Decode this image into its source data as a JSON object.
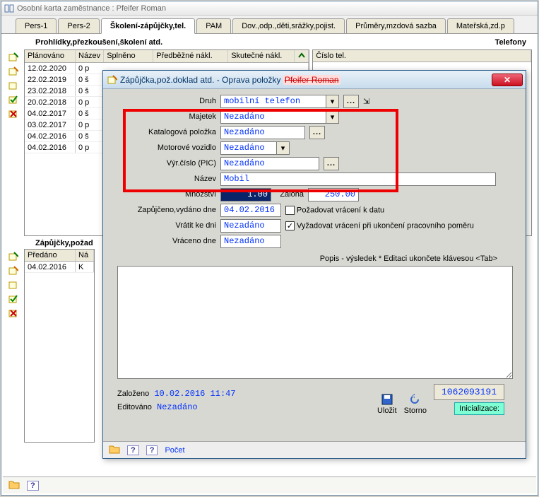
{
  "window": {
    "title": "Osobní karta zaměstnance : Pfeifer Roman"
  },
  "tabs": [
    {
      "label": "Pers-1"
    },
    {
      "label": "Pers-2"
    },
    {
      "label": "Školení-zápůjčky,tel.",
      "active": true
    },
    {
      "label": "PAM"
    },
    {
      "label": "Dov.,odp.,děti,srážky,pojist."
    },
    {
      "label": "Průměry,mzdová sazba"
    },
    {
      "label": "Mateřská,zd.p"
    }
  ],
  "sub": {
    "left": "Prohlídky,přezkoušení,školení atd.",
    "right": "Telefony"
  },
  "grid1": {
    "headers": [
      "Plánováno",
      "Název",
      "Splněno",
      "Předběžné nákl.",
      "Skutečné nákl."
    ],
    "rows": [
      [
        "12.02.2020",
        "0 p"
      ],
      [
        "22.02.2019",
        "0 š"
      ],
      [
        "23.02.2018",
        "0 š"
      ],
      [
        "20.02.2018",
        "0 p"
      ],
      [
        "04.02.2017",
        "0 š"
      ],
      [
        "03.02.2017",
        "0 p"
      ],
      [
        "04.02.2016",
        "0 š"
      ],
      [
        "04.02.2016",
        "0 p"
      ]
    ]
  },
  "tel_header": "Číslo tel.",
  "sec2": "Zápůjčky,požad",
  "grid2": {
    "headers": [
      "Předáno",
      "Ná"
    ],
    "rows": [
      [
        "04.02.2016",
        "K"
      ]
    ]
  },
  "dialog": {
    "title_prefix": "Zápůjčka,pož.doklad atd. - Oprava položky",
    "title_struck": "Pfeifer Roman",
    "fields": {
      "druh_label": "Druh",
      "druh_value": "mobilní telefon",
      "majetek_label": "Majetek",
      "majetek_value": "Nezadáno",
      "katalog_label": "Katalogová položka",
      "katalog_value": "Nezadáno",
      "motor_label": "Motorové vozidlo",
      "motor_value": "Nezadáno",
      "pic_label": "Výr.číslo (PIC)",
      "pic_value": "Nezadáno",
      "nazev_label": "Název",
      "nazev_value": "Mobil",
      "mnozstvi_label": "Množství",
      "mnozstvi_value": "1.00",
      "zaloha_label": "Záloha",
      "zaloha_value": "250.00",
      "zap_label": "Zapůjčeno,vydáno dne",
      "zap_value": "04.02.2016",
      "poz_label": "Požadovat vrácení k datu",
      "vratit_label": "Vrátit ke dni",
      "vratit_value": "Nezadáno",
      "vyz_label": "Vyžadovat vrácení při ukončení pracovního poměru",
      "vyz_checked": true,
      "vrac_label": "Vráceno dne",
      "vrac_value": "Nezadáno"
    },
    "desc_label": "Popis  - výsledek *   Editaci ukončete klávesou <Tab>",
    "footer": {
      "zalozeno_label": "Založeno",
      "zalozeno_value": "10.02.2016 11:47",
      "editovano_label": "Editováno",
      "editovano_value": "Nezadáno",
      "ulozit": "Uložit",
      "storno": "Storno",
      "init": "Inicializace:",
      "number": "1062093191"
    },
    "status": {
      "pocet": "Počet"
    }
  }
}
